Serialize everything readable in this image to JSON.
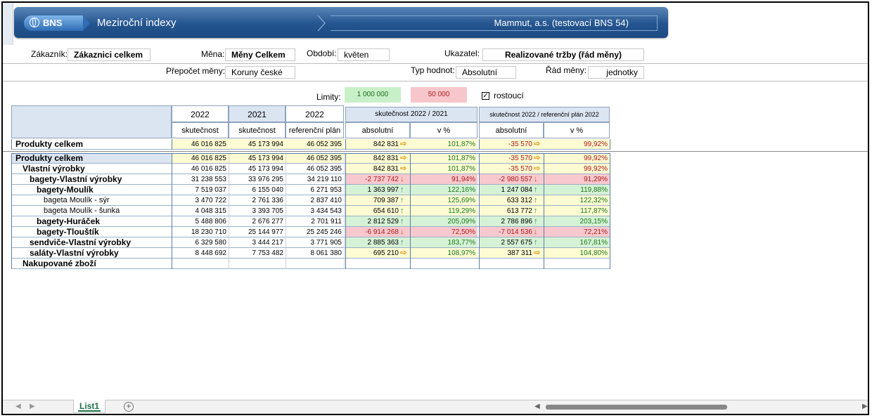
{
  "banner": {
    "logo": "BNS",
    "title": "Meziroční indexy",
    "company": "Mammut, a.s. (testovací BNS 54)"
  },
  "filters": {
    "zakaznik_label": "Zákazník:",
    "zakaznik_value": "Zákaznici celkem",
    "mena_label": "Měna:",
    "mena_value": "Měny Celkem",
    "obdobi_label": "Období:",
    "obdobi_value": "květen",
    "ukazatel_label": "Ukazatel:",
    "ukazatel_value": "Realizované tržby (řád měny)",
    "prepocet_label": "Přepočet měny:",
    "prepocet_value": "Koruny české",
    "typ_label": "Typ hodnot:",
    "typ_value": "Absolutní",
    "rad_label": "Řád měny:",
    "rad_value": "jednotky"
  },
  "limits": {
    "label": "Limity:",
    "green": "1 000 000",
    "red": "50 000",
    "checkbox_label": "rostoucí",
    "checked": "✓"
  },
  "headers": {
    "y2022": "2022",
    "y2021": "2021",
    "y2022b": "2022",
    "skutecnost": "skutečnost",
    "referencni": "referenční plán",
    "grp1": "skutečnost 2022 / 2021",
    "grp2": "skutečnost 2022 / referenční plán 2022",
    "absolutni": "absolutní",
    "vpct": "v %"
  },
  "total": {
    "name": "Produkty celkem",
    "c1": "46 016 825",
    "c2": "45 173 994",
    "c3": "46 052 395",
    "a1": "842 831",
    "p1": "101,87%",
    "a2": "-35 570",
    "p2": "99,92%"
  },
  "rows": [
    {
      "name": "Produkty celkem",
      "c1": "46 016 825",
      "c2": "45 173 994",
      "c3": "46 052 395",
      "a1": "842 831",
      "p1": "101,87%",
      "a2": "-35 570",
      "p2": "99,92%"
    },
    {
      "name": "Vlastní výrobky",
      "c1": "46 016 825",
      "c2": "45 173 994",
      "c3": "46 052 395",
      "a1": "842 831",
      "p1": "101,87%",
      "a2": "-35 570",
      "p2": "99,92%"
    },
    {
      "name": "bagety-Vlastní výrobky",
      "c1": "31 238 553",
      "c2": "33 976 295",
      "c3": "34 219 110",
      "a1": "-2 737 742",
      "p1": "91,94%",
      "a2": "-2 980 557",
      "p2": "91,29%"
    },
    {
      "name": "bagety-Moulík",
      "c1": "7 519 037",
      "c2": "6 155 040",
      "c3": "6 271 953",
      "a1": "1 363 997",
      "p1": "122,16%",
      "a2": "1 247 084",
      "p2": "119,88%"
    },
    {
      "name": "bageta Moulík - sýr",
      "c1": "3 470 722",
      "c2": "2 761 336",
      "c3": "2 837 410",
      "a1": "709 387",
      "p1": "125,69%",
      "a2": "633 312",
      "p2": "122,32%"
    },
    {
      "name": "bageta Moulík - šunka",
      "c1": "4 048 315",
      "c2": "3 393 705",
      "c3": "3 434 543",
      "a1": "654 610",
      "p1": "119,29%",
      "a2": "613 772",
      "p2": "117,87%"
    },
    {
      "name": "bagety-Huráček",
      "c1": "5 488 806",
      "c2": "2 676 277",
      "c3": "2 701 911",
      "a1": "2 812 529",
      "p1": "205,09%",
      "a2": "2 786 896",
      "p2": "203,15%"
    },
    {
      "name": "bagety-Tlouštík",
      "c1": "18 230 710",
      "c2": "25 144 977",
      "c3": "25 245 246",
      "a1": "-6 914 268",
      "p1": "72,50%",
      "a2": "-7 014 536",
      "p2": "72,21%"
    },
    {
      "name": "sendviče-Vlastní výrobky",
      "c1": "6 329 580",
      "c2": "3 444 217",
      "c3": "3 771 905",
      "a1": "2 885 363",
      "p1": "183,77%",
      "a2": "2 557 675",
      "p2": "167,81%"
    },
    {
      "name": "saláty-Vlastní výrobky",
      "c1": "8 448 692",
      "c2": "7 753 482",
      "c3": "8 061 380",
      "a1": "695 210",
      "p1": "108,97%",
      "a2": "387 311",
      "p2": "104,80%"
    },
    {
      "name": "Nakupované zboží",
      "c1": "",
      "c2": "",
      "c3": "",
      "a1": "",
      "p1": "",
      "a2": "",
      "p2": ""
    }
  ],
  "sheet_tab": "List1",
  "colors": {
    "green_fill": "#d6f2d6",
    "red_fill": "#f7c9ce",
    "yellow_fill": "#fdfbd2",
    "header_blue": "#dbe5f1",
    "pct_green": "#1a7a1a",
    "pct_red": "#b01818"
  }
}
